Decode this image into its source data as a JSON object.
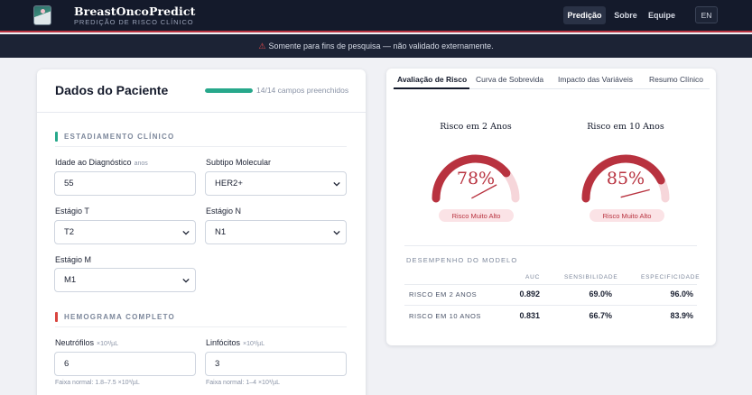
{
  "header": {
    "brand_title": "BreastOncoPredict",
    "brand_subtitle": "PREDIÇÃO DE RISCO CLÍNICO",
    "nav": [
      "Predição",
      "Sobre",
      "Equipe"
    ],
    "lang": "EN"
  },
  "banner": {
    "icon": "warning-icon",
    "text": "Somente para fins de pesquisa — não validado externamente."
  },
  "patient": {
    "title": "Dados do Paciente",
    "progress_text": "14/14 campos preenchidos",
    "progress_fraction": 1.0,
    "section_staging": "ESTADIAMENTO CLÍNICO",
    "age_label": "Idade ao Diagnóstico",
    "age_unit": "anos",
    "age_value": "55",
    "subtype_label": "Subtipo Molecular",
    "subtype_value": "HER2+",
    "t_label": "Estágio T",
    "t_value": "T2",
    "n_label": "Estágio N",
    "n_value": "N1",
    "m_label": "Estágio M",
    "m_value": "M1",
    "section_blood": "HEMOGRAMA COMPLETO",
    "neut_label": "Neutrófilos",
    "neut_unit": "×10³/µL",
    "neut_value": "6",
    "neut_hint": "Faixa normal: 1.8–7.5 ×10³/µL",
    "lymph_label": "Linfócitos",
    "lymph_unit": "×10³/µL",
    "lymph_value": "3",
    "lymph_hint": "Faixa normal: 1–4 ×10³/µL"
  },
  "results": {
    "tabs": [
      "Avaliação de Risco",
      "Curva de Sobrevida",
      "Impacto das Variáveis",
      "Resumo Clínico"
    ],
    "gauges": [
      {
        "title": "Risco em 2 Anos",
        "value": 78,
        "display": "78%",
        "badge": "Risco Muito Alto"
      },
      {
        "title": "Risco em 10 Anos",
        "value": 85,
        "display": "85%",
        "badge": "Risco Muito Alto"
      }
    ],
    "perf_title": "DESEMPENHO DO MODELO",
    "columns": [
      "AUC",
      "SENSIBILIDADE",
      "ESPECIFICIDADE"
    ],
    "rows": [
      {
        "label": "RISCO EM 2 ANOS",
        "auc": "0.892",
        "sens": "69.0%",
        "spec": "96.0%"
      },
      {
        "label": "RISCO EM 10 ANOS",
        "auc": "0.831",
        "sens": "66.7%",
        "spec": "83.9%"
      }
    ]
  },
  "colors": {
    "accent_red": "#b8323f",
    "track_pink": "#f6d6da",
    "accent_green": "#27a88b",
    "navy": "#141a2b"
  }
}
